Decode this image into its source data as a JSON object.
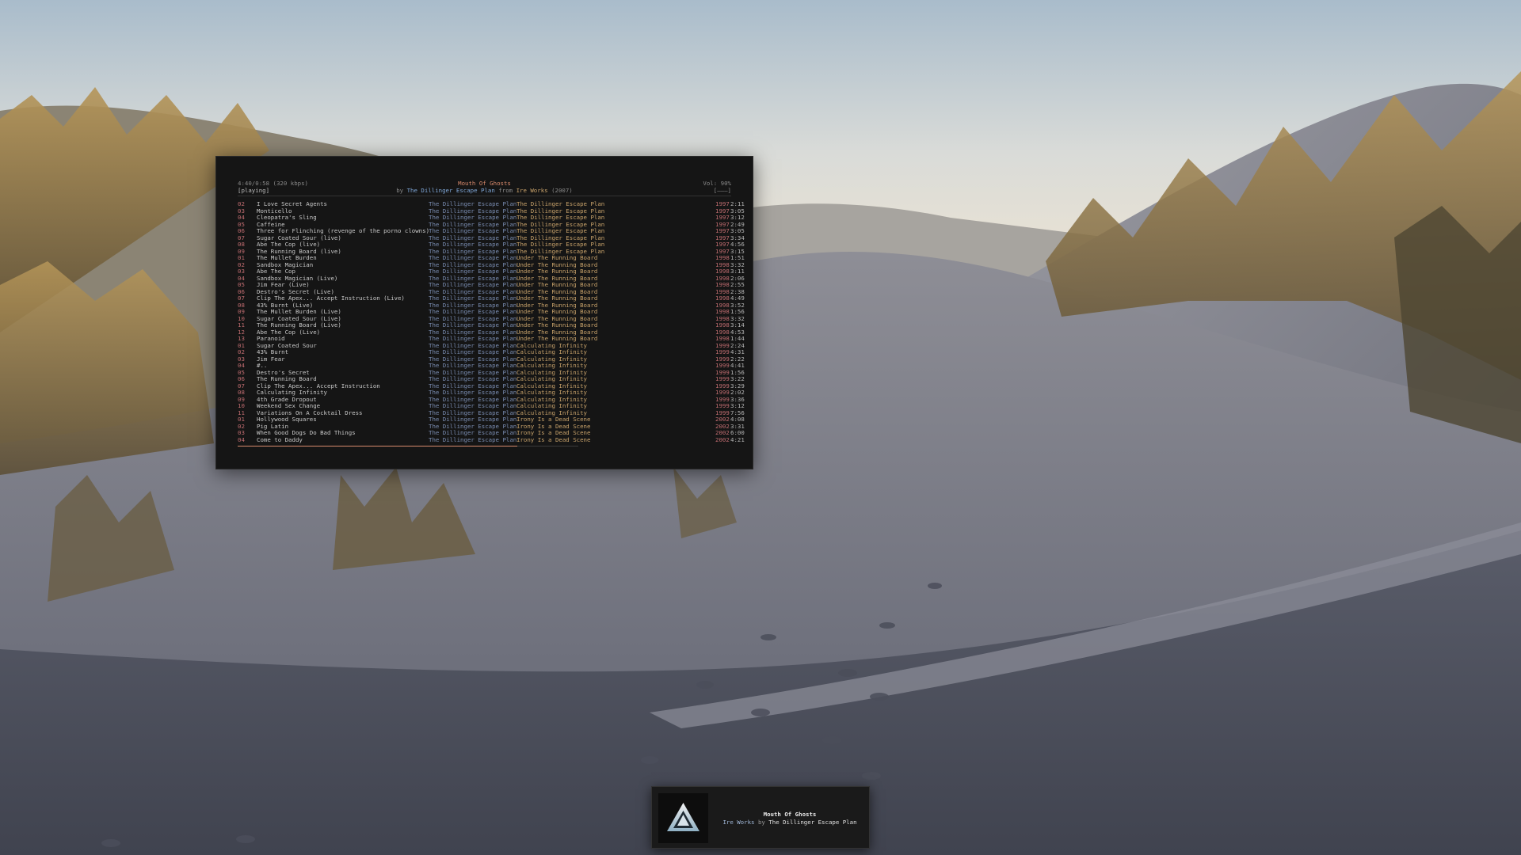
{
  "player": {
    "position": "4:40/0:58 (320 kbps)",
    "state": "[playing]",
    "now_title": "Mouth Of Ghosts",
    "by_word": "by",
    "from_word": "from",
    "now_artist": "The Dillinger Escape Plan",
    "now_album": "Ire Works",
    "now_year": "(2007)",
    "volume": "Vol: 90%",
    "volume_bar": "[———]",
    "progress_fraction": 0.82,
    "tracks": [
      {
        "num": "02",
        "title": "I Love Secret Agents",
        "artist": "The Dillinger Escape Plan",
        "album": "The Dillinger Escape Plan",
        "year": "1997",
        "dur": "2:11"
      },
      {
        "num": "03",
        "title": "Monticello",
        "artist": "The Dillinger Escape Plan",
        "album": "The Dillinger Escape Plan",
        "year": "1997",
        "dur": "3:05"
      },
      {
        "num": "04",
        "title": "Cleopatra's Sling",
        "artist": "The Dillinger Escape Plan",
        "album": "The Dillinger Escape Plan",
        "year": "1997",
        "dur": "3:12"
      },
      {
        "num": "05",
        "title": "Caffeine",
        "artist": "The Dillinger Escape Plan",
        "album": "The Dillinger Escape Plan",
        "year": "1997",
        "dur": "2:49"
      },
      {
        "num": "06",
        "title": "Three for Flinching (revenge of the porno clowns)",
        "artist": "The Dillinger Escape Plan",
        "album": "The Dillinger Escape Plan",
        "year": "1997",
        "dur": "3:05"
      },
      {
        "num": "07",
        "title": "Sugar Coated Sour (live)",
        "artist": "The Dillinger Escape Plan",
        "album": "The Dillinger Escape Plan",
        "year": "1997",
        "dur": "3:34"
      },
      {
        "num": "08",
        "title": "Abe The Cop (live)",
        "artist": "The Dillinger Escape Plan",
        "album": "The Dillinger Escape Plan",
        "year": "1997",
        "dur": "4:56"
      },
      {
        "num": "09",
        "title": "The Running Board (live)",
        "artist": "The Dillinger Escape Plan",
        "album": "The Dillinger Escape Plan",
        "year": "1997",
        "dur": "3:15"
      },
      {
        "num": "01",
        "title": "The Mullet Burden",
        "artist": "The Dillinger Escape Plan",
        "album": "Under The Running Board",
        "year": "1998",
        "dur": "1:51"
      },
      {
        "num": "02",
        "title": "Sandbox Magician",
        "artist": "The Dillinger Escape Plan",
        "album": "Under The Running Board",
        "year": "1998",
        "dur": "3:32"
      },
      {
        "num": "03",
        "title": "Abe The Cop",
        "artist": "The Dillinger Escape Plan",
        "album": "Under The Running Board",
        "year": "1998",
        "dur": "3:11"
      },
      {
        "num": "04",
        "title": "Sandbox Magician (Live)",
        "artist": "The Dillinger Escape Plan",
        "album": "Under The Running Board",
        "year": "1998",
        "dur": "2:06"
      },
      {
        "num": "05",
        "title": "Jim Fear (Live)",
        "artist": "The Dillinger Escape Plan",
        "album": "Under The Running Board",
        "year": "1998",
        "dur": "2:55"
      },
      {
        "num": "06",
        "title": "Destro's Secret (Live)",
        "artist": "The Dillinger Escape Plan",
        "album": "Under The Running Board",
        "year": "1998",
        "dur": "2:38"
      },
      {
        "num": "07",
        "title": "Clip The Apex... Accept Instruction (Live)",
        "artist": "The Dillinger Escape Plan",
        "album": "Under The Running Board",
        "year": "1998",
        "dur": "4:49"
      },
      {
        "num": "08",
        "title": "43% Burnt (Live)",
        "artist": "The Dillinger Escape Plan",
        "album": "Under The Running Board",
        "year": "1998",
        "dur": "3:52"
      },
      {
        "num": "09",
        "title": "The Mullet Burden (Live)",
        "artist": "The Dillinger Escape Plan",
        "album": "Under The Running Board",
        "year": "1998",
        "dur": "1:56"
      },
      {
        "num": "10",
        "title": "Sugar Coated Sour (Live)",
        "artist": "The Dillinger Escape Plan",
        "album": "Under The Running Board",
        "year": "1998",
        "dur": "3:32"
      },
      {
        "num": "11",
        "title": "The Running Board (Live)",
        "artist": "The Dillinger Escape Plan",
        "album": "Under The Running Board",
        "year": "1998",
        "dur": "3:14"
      },
      {
        "num": "12",
        "title": "Abe The Cop (Live)",
        "artist": "The Dillinger Escape Plan",
        "album": "Under The Running Board",
        "year": "1998",
        "dur": "4:53"
      },
      {
        "num": "13",
        "title": "Paranoid",
        "artist": "The Dillinger Escape Plan",
        "album": "Under The Running Board",
        "year": "1998",
        "dur": "1:44"
      },
      {
        "num": "01",
        "title": "Sugar Coated Sour",
        "artist": "The Dillinger Escape Plan",
        "album": "Calculating Infinity",
        "year": "1999",
        "dur": "2:24"
      },
      {
        "num": "02",
        "title": "43% Burnt",
        "artist": "The Dillinger Escape Plan",
        "album": "Calculating Infinity",
        "year": "1999",
        "dur": "4:31"
      },
      {
        "num": "03",
        "title": "Jim Fear",
        "artist": "The Dillinger Escape Plan",
        "album": "Calculating Infinity",
        "year": "1999",
        "dur": "2:22"
      },
      {
        "num": "04",
        "title": "#..",
        "artist": "The Dillinger Escape Plan",
        "album": "Calculating Infinity",
        "year": "1999",
        "dur": "4:41"
      },
      {
        "num": "05",
        "title": "Destro's Secret",
        "artist": "The Dillinger Escape Plan",
        "album": "Calculating Infinity",
        "year": "1999",
        "dur": "1:56"
      },
      {
        "num": "06",
        "title": "The Running Board",
        "artist": "The Dillinger Escape Plan",
        "album": "Calculating Infinity",
        "year": "1999",
        "dur": "3:22"
      },
      {
        "num": "07",
        "title": "Clip The Apex... Accept Instruction",
        "artist": "The Dillinger Escape Plan",
        "album": "Calculating Infinity",
        "year": "1999",
        "dur": "3:29"
      },
      {
        "num": "08",
        "title": "Calculating Infinity",
        "artist": "The Dillinger Escape Plan",
        "album": "Calculating Infinity",
        "year": "1999",
        "dur": "2:02"
      },
      {
        "num": "09",
        "title": "4th Grade Dropout",
        "artist": "The Dillinger Escape Plan",
        "album": "Calculating Infinity",
        "year": "1999",
        "dur": "3:36"
      },
      {
        "num": "10",
        "title": "Weekend Sex Change",
        "artist": "The Dillinger Escape Plan",
        "album": "Calculating Infinity",
        "year": "1999",
        "dur": "3:12"
      },
      {
        "num": "11",
        "title": "Variations On A Cocktail Dress",
        "artist": "The Dillinger Escape Plan",
        "album": "Calculating Infinity",
        "year": "1999",
        "dur": "7:56"
      },
      {
        "num": "01",
        "title": "Hollywood Squares",
        "artist": "The Dillinger Escape Plan",
        "album": "Irony Is a Dead Scene",
        "year": "2002",
        "dur": "4:08"
      },
      {
        "num": "02",
        "title": "Pig Latin",
        "artist": "The Dillinger Escape Plan",
        "album": "Irony Is a Dead Scene",
        "year": "2002",
        "dur": "3:31"
      },
      {
        "num": "03",
        "title": "When Good Dogs Do Bad Things",
        "artist": "The Dillinger Escape Plan",
        "album": "Irony Is a Dead Scene",
        "year": "2002",
        "dur": "6:00"
      },
      {
        "num": "04",
        "title": "Come to Daddy",
        "artist": "The Dillinger Escape Plan",
        "album": "Irony Is a Dead Scene",
        "year": "2002",
        "dur": "4:21"
      }
    ]
  },
  "notification": {
    "title": "Mouth Of Ghosts",
    "album": "Ire Works",
    "by": "by",
    "artist": "The Dillinger Escape Plan"
  },
  "colors": {
    "track_number": "#c06c70",
    "artist": "#7a8db2",
    "album": "#c9a36b",
    "now_title": "#d98a6c"
  },
  "icons": {
    "album_cover": "triangle-album-art-icon"
  }
}
